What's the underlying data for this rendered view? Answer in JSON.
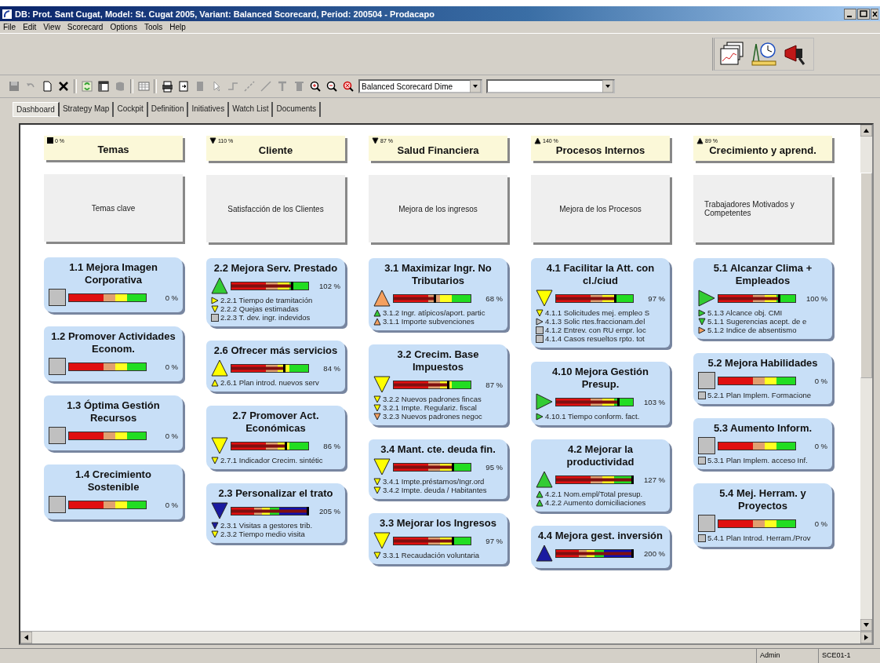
{
  "window": {
    "title": "DB: Prot. Sant Cugat, Model: St. Cugat 2005, Variant: Balanced Scorecard, Period: 200504 - Prodacapo"
  },
  "menu": [
    "File",
    "Edit",
    "View",
    "Scorecard",
    "Options",
    "Tools",
    "Help"
  ],
  "toolbar": {
    "dimension_combo": "Balanced Scorecard Dime"
  },
  "tabs": [
    {
      "label": "Dashboard",
      "selected": true
    },
    {
      "label": "Strategy Map",
      "selected": false
    },
    {
      "label": "Cockpit",
      "selected": false
    },
    {
      "label": "Definition",
      "selected": false
    },
    {
      "label": "Initiatives",
      "selected": false
    },
    {
      "label": "Watch List",
      "selected": false
    },
    {
      "label": "Documents",
      "selected": false
    }
  ],
  "columns": [
    {
      "title": "Temas",
      "status": {
        "kind": "square",
        "reading": "0 %"
      },
      "theme": "Temas clave",
      "cards": [
        {
          "title": "1.1 Mejora Imagen Corporativa",
          "icon": {
            "kind": "square",
            "color": "#c0c0c0"
          },
          "gauge": {
            "kind": "standard"
          },
          "reading": "0 %"
        },
        {
          "title": "1.2 Promover Actividades Econom.",
          "icon": {
            "kind": "square",
            "color": "#c0c0c0"
          },
          "gauge": {
            "kind": "standard"
          },
          "reading": "0 %"
        },
        {
          "title": "1.3 Óptima Gestión Recursos",
          "icon": {
            "kind": "square",
            "color": "#c0c0c0"
          },
          "gauge": {
            "kind": "standard"
          },
          "reading": "0 %"
        },
        {
          "title": "1.4 Crecimiento Sostenible",
          "icon": {
            "kind": "square",
            "color": "#c0c0c0"
          },
          "gauge": {
            "kind": "standard"
          },
          "reading": "0 %"
        }
      ]
    },
    {
      "title": "Cliente",
      "status": {
        "kind": "down",
        "reading": "110 %"
      },
      "theme": "Satisfacción de los Clientes",
      "cards": [
        {
          "title": "2.2 Mejora Serv. Prestado",
          "icon": {
            "kind": "up",
            "color": "#33cc33"
          },
          "gauge": {
            "kind": "standard",
            "level": 0.8
          },
          "reading": "102 %",
          "indicators": [
            {
              "kind": "right",
              "color": "#ffff00",
              "text": "2.2.1 Tiempo de tramitación"
            },
            {
              "kind": "down",
              "color": "#ffff00",
              "text": "2.2.2 Quejas estimadas"
            },
            {
              "kind": "square",
              "color": "#c0c0c0",
              "text": "2.2.3 T. dev. ingr. indevidos"
            }
          ]
        },
        {
          "title": "2.6 Ofrecer más servicios",
          "icon": {
            "kind": "up",
            "color": "#ffff00"
          },
          "gauge": {
            "kind": "standard",
            "level": 0.7
          },
          "reading": "84 %",
          "indicators": [
            {
              "kind": "up",
              "color": "#ffff00",
              "text": "2.6.1 Plan introd. nuevos serv"
            }
          ]
        },
        {
          "title": "2.7 Promover Act. Económicas",
          "icon": {
            "kind": "down",
            "color": "#ffff00"
          },
          "gauge": {
            "kind": "standard",
            "level": 0.72
          },
          "reading": "86 %",
          "indicators": [
            {
              "kind": "down",
              "color": "#ffff00",
              "text": "2.7.1 Indicador Crecim. sintétic"
            }
          ]
        },
        {
          "title": "2.3 Personalizar el trato",
          "icon": {
            "kind": "down",
            "color": "#1a1aa0"
          },
          "gauge": {
            "kind": "extended",
            "level": 1
          },
          "reading": "205 %",
          "indicators": [
            {
              "kind": "down",
              "color": "#1a1aa0",
              "text": "2.3.1 Visitas a gestores trib."
            },
            {
              "kind": "down",
              "color": "#ffff00",
              "text": "2.3.2 Tiempo medio visita"
            }
          ]
        }
      ]
    },
    {
      "title": "Salud Financiera",
      "status": {
        "kind": "down",
        "reading": "87 %"
      },
      "theme": "Mejora de los ingresos",
      "cards": [
        {
          "title": "3.1 Maximizar Ingr. No Tributarios",
          "icon": {
            "kind": "up",
            "color": "#f4a060"
          },
          "gauge": {
            "kind": "standard",
            "level": 0.55
          },
          "reading": "68 %",
          "indicators": [
            {
              "kind": "up",
              "color": "#33cc33",
              "text": "3.1.2 Ingr. atípicos/aport. partic"
            },
            {
              "kind": "up",
              "color": "#f4a060",
              "text": "3.1.1 Importe subvenciones"
            }
          ]
        },
        {
          "title": "3.2 Crecim. Base Impuestos",
          "icon": {
            "kind": "down",
            "color": "#ffff00"
          },
          "gauge": {
            "kind": "standard",
            "level": 0.72
          },
          "reading": "87 %",
          "indicators": [
            {
              "kind": "down",
              "color": "#ffff00",
              "text": "3.2.2 Nuevos padrones fincas"
            },
            {
              "kind": "down",
              "color": "#ffff00",
              "text": "3.2.1 Impte. Regulariz. fiscal"
            },
            {
              "kind": "down",
              "color": "#f4a060",
              "text": "3.2.3 Nuevos padrones negoc"
            }
          ]
        },
        {
          "title": "3.4 Mant. cte. deuda fin.",
          "icon": {
            "kind": "down",
            "color": "#ffff00"
          },
          "gauge": {
            "kind": "standard",
            "level": 0.78
          },
          "reading": "95 %",
          "indicators": [
            {
              "kind": "down",
              "color": "#ffff00",
              "text": "3.4.1 Impte.préstamos/Ingr.ord"
            },
            {
              "kind": "down",
              "color": "#ffff00",
              "text": "3.4.2 Impte. deuda / Habitantes"
            }
          ]
        },
        {
          "title": "3.3 Mejorar los Ingresos",
          "icon": {
            "kind": "down",
            "color": "#ffff00"
          },
          "gauge": {
            "kind": "standard",
            "level": 0.78
          },
          "reading": "97 %",
          "indicators": [
            {
              "kind": "down",
              "color": "#ffff00",
              "text": "3.3.1 Recaudación voluntaria"
            }
          ]
        }
      ]
    },
    {
      "title": "Procesos Internos",
      "status": {
        "kind": "up",
        "reading": "140 %"
      },
      "theme": "Mejora de los Procesos",
      "cards": [
        {
          "title": "4.1 Facilitar la Att. con cl./ciud",
          "icon": {
            "kind": "down",
            "color": "#ffff00"
          },
          "gauge": {
            "kind": "standard",
            "level": 0.78
          },
          "reading": "97 %",
          "indicators": [
            {
              "kind": "down",
              "color": "#ffff00",
              "text": "4.1.1 Solicitudes mej. empleo S"
            },
            {
              "kind": "right",
              "color": "#c0c0c0",
              "text": "4.1.3 Solic rtes.fraccionam.del"
            },
            {
              "kind": "square",
              "color": "#c0c0c0",
              "text": "4.1.2 Entrev. con RU empr. loc"
            },
            {
              "kind": "square",
              "color": "#c0c0c0",
              "text": "4.1.4 Casos resueltos rpto. tot"
            }
          ]
        },
        {
          "title": "4.10 Mejora Gestión Presup.",
          "icon": {
            "kind": "right",
            "color": "#33cc33"
          },
          "gauge": {
            "kind": "standard",
            "level": 0.82
          },
          "reading": "103 %",
          "indicators": [
            {
              "kind": "right",
              "color": "#33cc33",
              "text": "4.10.1 Tiempo conform. fact."
            }
          ]
        },
        {
          "title": "4.2 Mejorar la productividad",
          "icon": {
            "kind": "up",
            "color": "#33cc33"
          },
          "gauge": {
            "kind": "standard",
            "level": 1
          },
          "reading": "127 %",
          "indicators": [
            {
              "kind": "up",
              "color": "#33cc33",
              "text": "4.2.1 Nom.empl/Total presup."
            },
            {
              "kind": "up",
              "color": "#33cc33",
              "text": "4.2.2 Aumento domiciliaciones"
            }
          ]
        },
        {
          "title": "4.4 Mejora gest. inversión",
          "icon": {
            "kind": "up",
            "color": "#1a1aa0"
          },
          "gauge": {
            "kind": "extended",
            "level": 1
          },
          "reading": "200 %"
        }
      ]
    },
    {
      "title": "Crecimiento y aprend.",
      "status": {
        "kind": "up",
        "reading": "89 %"
      },
      "theme": "Trabajadores Motivados y Competentes",
      "cards": [
        {
          "title": "5.1 Alcanzar Clima + Empleados",
          "icon": {
            "kind": "right",
            "color": "#33cc33"
          },
          "gauge": {
            "kind": "standard",
            "level": 0.8
          },
          "reading": "100 %",
          "indicators": [
            {
              "kind": "right",
              "color": "#33cc33",
              "text": "5.1.3 Alcance obj. CMI"
            },
            {
              "kind": "down",
              "color": "#33cc33",
              "text": "5.1.1 Sugerencias acept. de e"
            },
            {
              "kind": "right",
              "color": "#f4a060",
              "text": "5.1.2 Indice de absentismo"
            }
          ]
        },
        {
          "title": "5.2 Mejora Habilidades",
          "icon": {
            "kind": "square",
            "color": "#c0c0c0"
          },
          "gauge": {
            "kind": "standard"
          },
          "reading": "0 %",
          "indicators": [
            {
              "kind": "square",
              "color": "#c0c0c0",
              "text": "5.2.1 Plan Implem. Formacione"
            }
          ]
        },
        {
          "title": "5.3 Aumento Inform.",
          "icon": {
            "kind": "square",
            "color": "#c0c0c0"
          },
          "gauge": {
            "kind": "standard"
          },
          "reading": "0 %",
          "indicators": [
            {
              "kind": "square",
              "color": "#c0c0c0",
              "text": "5.3.1 Plan Implem. acceso Inf."
            }
          ]
        },
        {
          "title": "5.4 Mej. Herram. y Proyectos",
          "icon": {
            "kind": "square",
            "color": "#c0c0c0"
          },
          "gauge": {
            "kind": "standard"
          },
          "reading": "0 %",
          "indicators": [
            {
              "kind": "square",
              "color": "#c0c0c0",
              "text": "5.4.1 Plan Introd. Herram./Prov"
            }
          ]
        }
      ]
    }
  ],
  "status_bar": [
    "Admin",
    "SCE01-1"
  ]
}
